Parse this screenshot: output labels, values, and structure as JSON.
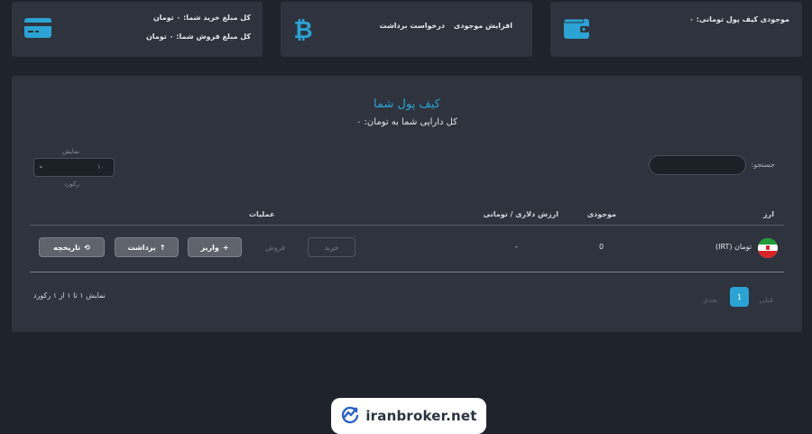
{
  "cards": {
    "wallet": {
      "text": "موجودی کیف پول تومانی: ۰",
      "icon": "wallet-icon"
    },
    "crypto": {
      "increase_label": "افزایش موجودی",
      "withdraw_label": "درخواست برداشت",
      "icon": "bitcoin-icon"
    },
    "summary": {
      "buy_total": "کل مبلغ خرید شما: ۰ تومان",
      "sell_total": "کل مبلغ فروش شما: ۰ تومان",
      "icon": "credit-card-icon"
    }
  },
  "main": {
    "title": "کیف پول شما",
    "subtitle": "کل دارایی شما به تومان: ۰",
    "search_label": "جستجو:",
    "length_label": "نمایش",
    "length_value": "۱۰",
    "records_label": "رکورد",
    "columns": [
      "ارز",
      "موجودی",
      "ارزش دلاری / تومانی",
      "عملیات"
    ],
    "rows": [
      {
        "currency": "تومان (IRT)",
        "balance": "0",
        "value": "-"
      }
    ],
    "actions": {
      "buy": "خرید",
      "sell": "فروش",
      "deposit": "واریز",
      "withdraw": "برداشت",
      "history": "تاریخچه"
    },
    "info": "نمایش ۱ تا ۱ از ۱ رکورد",
    "pagination": {
      "prev": "قبلی",
      "current": "1",
      "next": "بعدی"
    }
  },
  "colors": {
    "accent": "#2ba3d4",
    "background": "#1f232b",
    "panel": "#2e333d"
  },
  "footer": {
    "brand": "iranbroker.net"
  }
}
